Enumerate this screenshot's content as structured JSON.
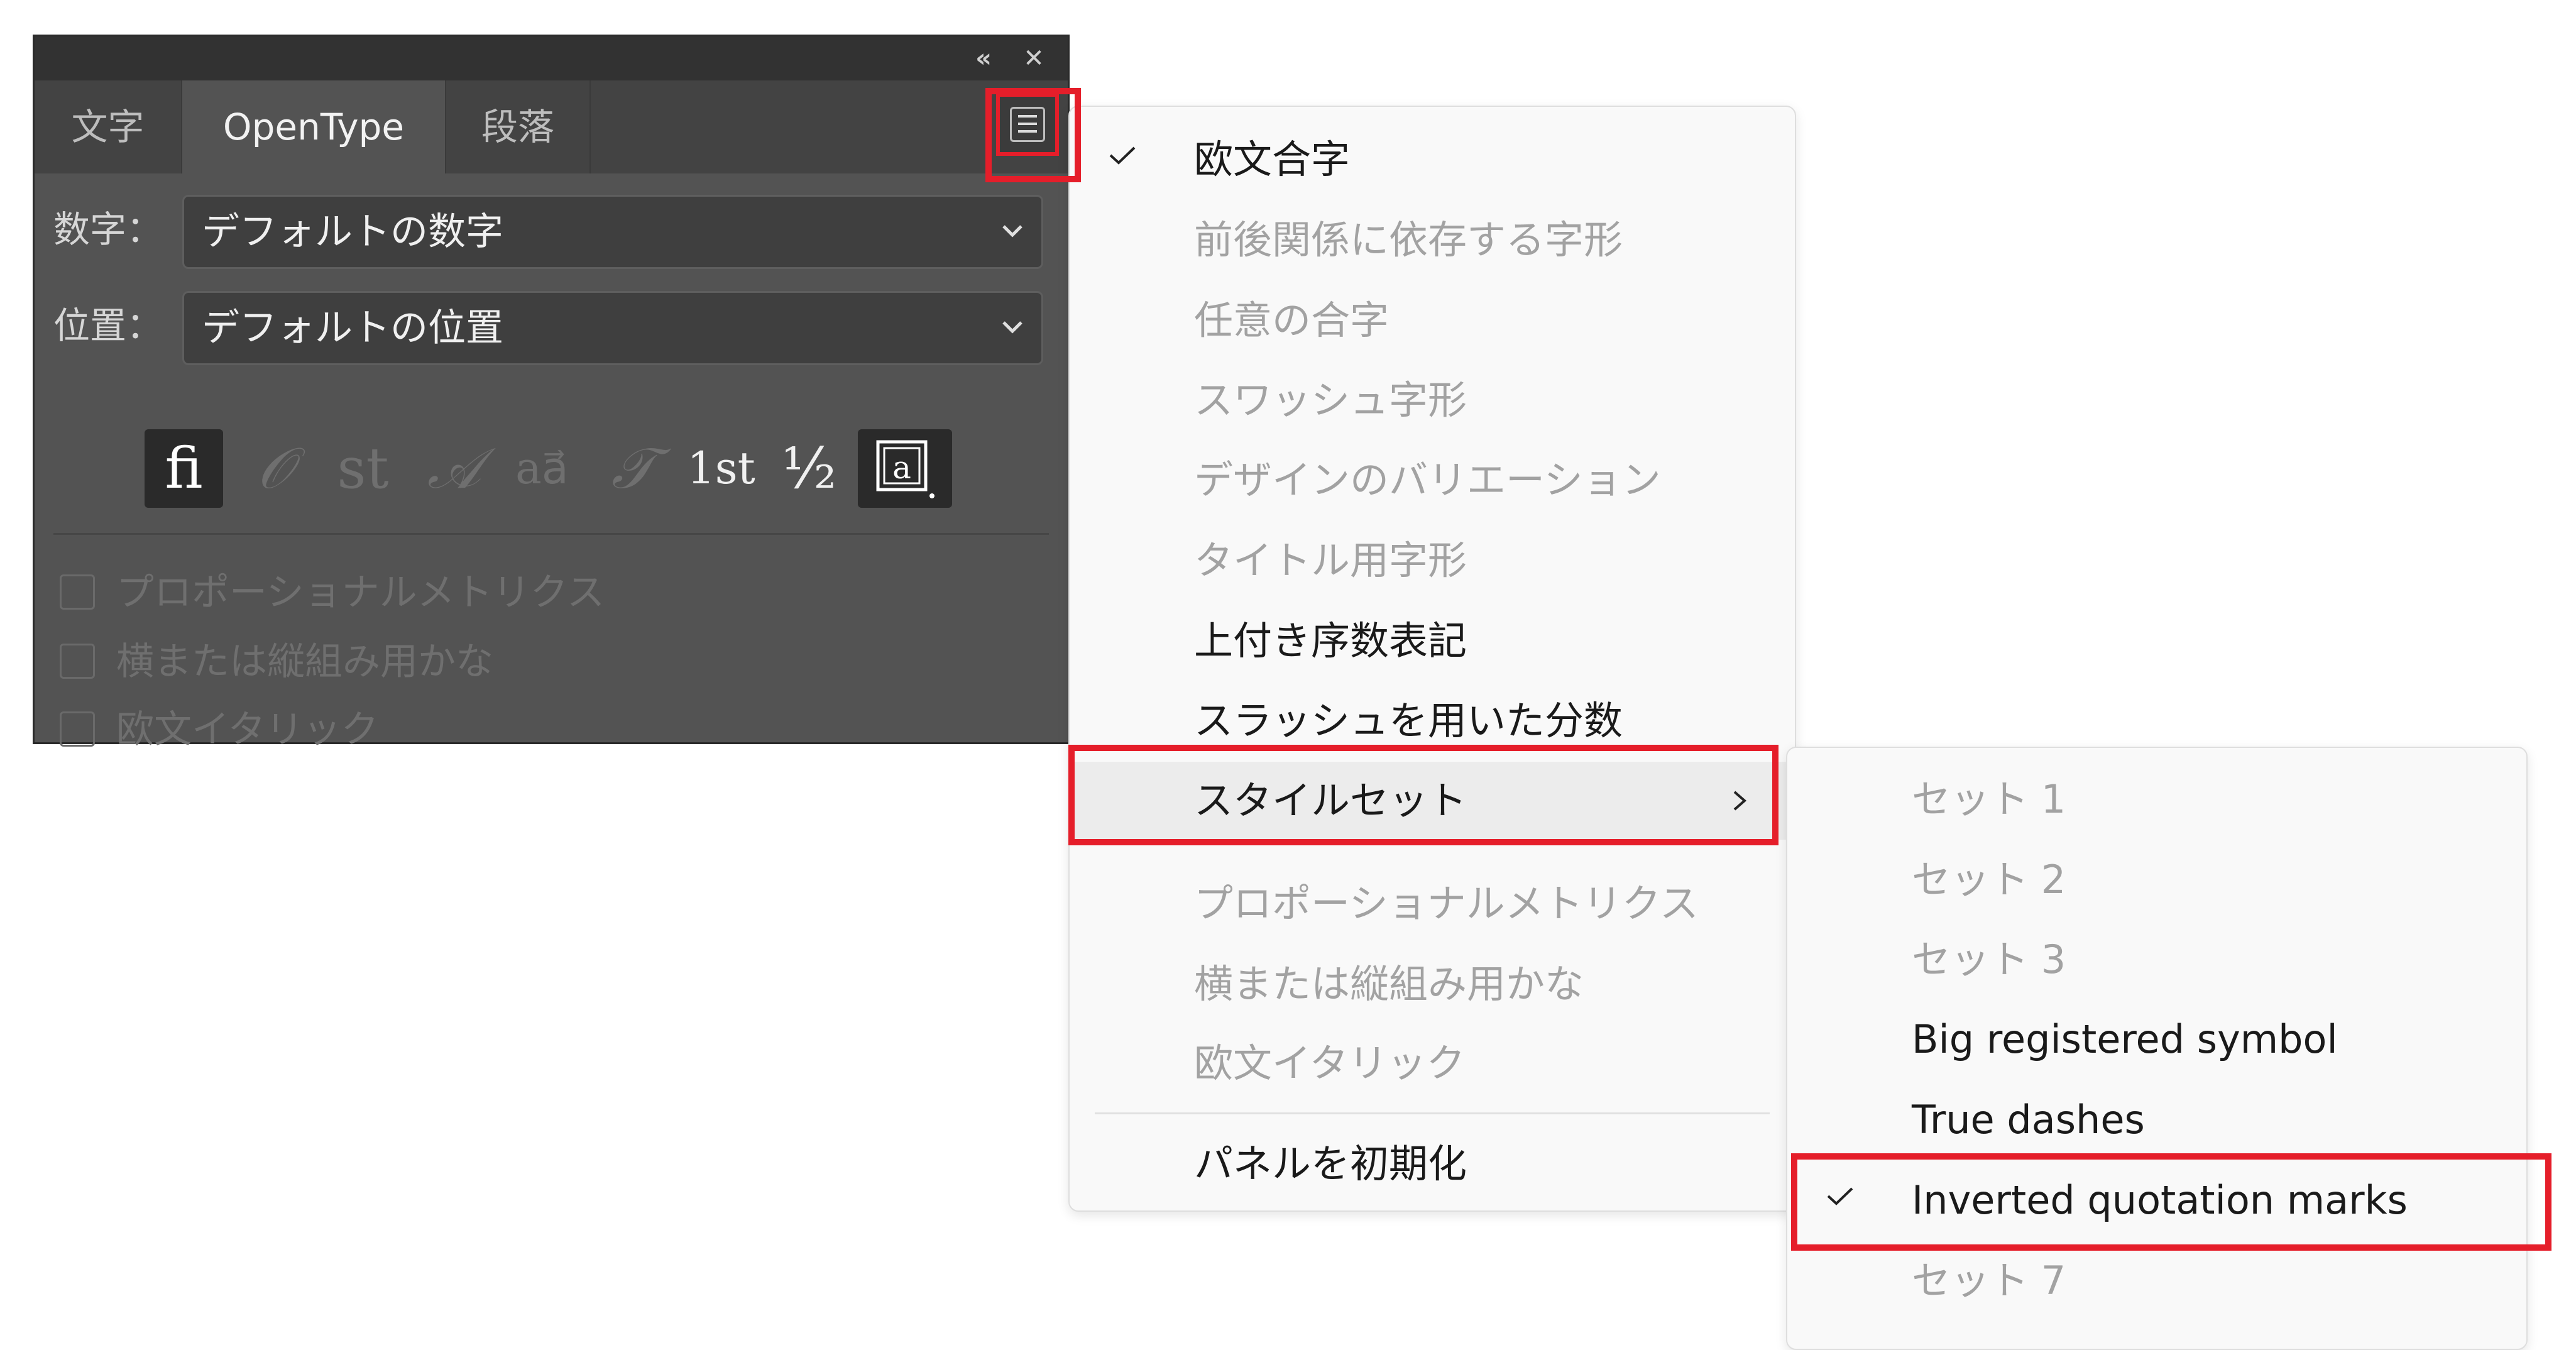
{
  "panel": {
    "collapse_icon": "«",
    "close_icon": "✕",
    "tabs": [
      "文字",
      "OpenType",
      "段落"
    ],
    "active_tab": "OpenType",
    "numbers_label": "数字：",
    "numbers_value": "デフォルトの数字",
    "position_label": "位置：",
    "position_value": "デフォルトの位置",
    "glyph_buttons": [
      {
        "glyph": "ﬁ",
        "icon": "standard-ligatures-icon",
        "active": true
      },
      {
        "glyph": "𝒪",
        "icon": "contextual-alternates-icon",
        "active": false
      },
      {
        "glyph": "st",
        "icon": "discretionary-ligatures-icon",
        "active": false
      },
      {
        "glyph": "𝒜",
        "icon": "swash-icon",
        "active": false
      },
      {
        "glyph": "aa⃗",
        "icon": "stylistic-alternates-icon",
        "active": false
      },
      {
        "glyph": "𝒯",
        "icon": "titling-alternates-icon",
        "active": false
      },
      {
        "glyph": "1st",
        "icon": "ordinals-icon",
        "active": false
      },
      {
        "glyph": "½",
        "icon": "fractions-icon",
        "active": false
      },
      {
        "glyph": "a͟",
        "icon": "stylistic-sets-icon",
        "active": true
      }
    ],
    "checkboxes": [
      "プロポーショナルメトリクス",
      "横または縦組み用かな",
      "欧文イタリック"
    ]
  },
  "menu": {
    "items": [
      {
        "label": "欧文合字",
        "checked": true,
        "disabled": false
      },
      {
        "label": "前後関係に依存する字形",
        "checked": false,
        "disabled": true
      },
      {
        "label": "任意の合字",
        "checked": false,
        "disabled": true
      },
      {
        "label": "スワッシュ字形",
        "checked": false,
        "disabled": true
      },
      {
        "label": "デザインのバリエーション",
        "checked": false,
        "disabled": true
      },
      {
        "label": "タイトル用字形",
        "checked": false,
        "disabled": true
      },
      {
        "label": "上付き序数表記",
        "checked": false,
        "disabled": false
      },
      {
        "label": "スラッシュを用いた分数",
        "checked": false,
        "disabled": false
      },
      {
        "label": "スタイルセット",
        "checked": false,
        "disabled": false,
        "submenu": true
      },
      {
        "label": "プロポーショナルメトリクス",
        "checked": false,
        "disabled": true
      },
      {
        "label": "横または縦組み用かな",
        "checked": false,
        "disabled": true
      },
      {
        "label": "欧文イタリック",
        "checked": false,
        "disabled": true
      },
      {
        "label": "パネルを初期化",
        "checked": false,
        "disabled": false
      }
    ]
  },
  "submenu": {
    "items": [
      {
        "label": "セット 1",
        "checked": false,
        "disabled": true
      },
      {
        "label": "セット 2",
        "checked": false,
        "disabled": true
      },
      {
        "label": "セット 3",
        "checked": false,
        "disabled": true
      },
      {
        "label": "Big registered symbol",
        "checked": false,
        "disabled": false
      },
      {
        "label": "True dashes",
        "checked": false,
        "disabled": false
      },
      {
        "label": "Inverted quotation marks",
        "checked": true,
        "disabled": false
      },
      {
        "label": "セット 7",
        "checked": false,
        "disabled": true
      }
    ]
  },
  "colors": {
    "highlight_outline": "#e51e2a",
    "panel_bg": "#535353",
    "menu_bg": "#f9f9f9"
  }
}
